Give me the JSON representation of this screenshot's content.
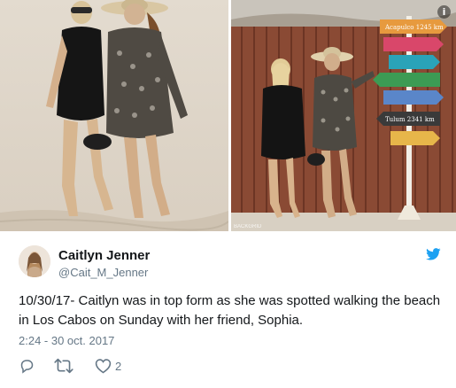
{
  "media": {
    "info_glyph": "i",
    "photo_credit": "BACKGRID",
    "signs": [
      "Acapulco 1245 km",
      "Tulum 2341 km"
    ]
  },
  "author": {
    "display_name": "Caitlyn Jenner",
    "screen_name": "@Cait_M_Jenner",
    "avatar_icon": "avatar-photo"
  },
  "brand": {
    "icon": "twitter-bird-icon",
    "color": "#1da1f2"
  },
  "tweet": {
    "text": "10/30/17- Caitlyn was in top form as she was spotted walking the beach in Los Cabos on Sunday with her friend, Sophia.",
    "timestamp": "2:24 - 30 oct. 2017"
  },
  "actions": {
    "reply_icon": "reply-icon",
    "retweet_icon": "retweet-icon",
    "like_icon": "heart-icon",
    "like_count": "2"
  },
  "colors": {
    "text": "#14171a",
    "secondary": "#657786",
    "icon": "#657786"
  }
}
